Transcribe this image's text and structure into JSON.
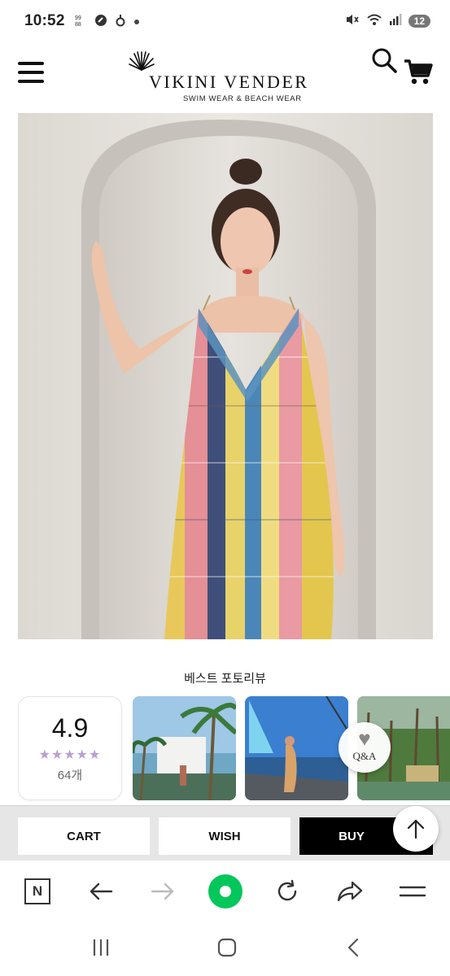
{
  "status_bar": {
    "time": "10:52",
    "left_icons": [
      "grid-notification-icon",
      "messenger-icon",
      "signal-app-icon",
      "dot-icon"
    ],
    "right_icons": [
      "mute-icon",
      "wifi-icon",
      "cell-signal-icon"
    ],
    "battery_level": "12"
  },
  "header": {
    "brand_name": "VIKINI VENDER",
    "brand_tagline": "SWIM WEAR & BEACH WEAR"
  },
  "product": {
    "image_alt": "model in patterned maxi slip dress"
  },
  "reviews": {
    "section_title": "베스트 포토리뷰",
    "rating": "4.9",
    "stars": "★★★★★",
    "count": "64개",
    "qa_label": "Q&A"
  },
  "actions": {
    "cart_label": "CART",
    "wish_label": "WISH",
    "buy_label": "BUY"
  },
  "browser": {
    "home_label": "N"
  },
  "colors": {
    "accent_green": "#03c75a",
    "star_color": "#b9a0d2",
    "buy_bg": "#000000",
    "action_bar_bg": "#e6e6e6"
  }
}
